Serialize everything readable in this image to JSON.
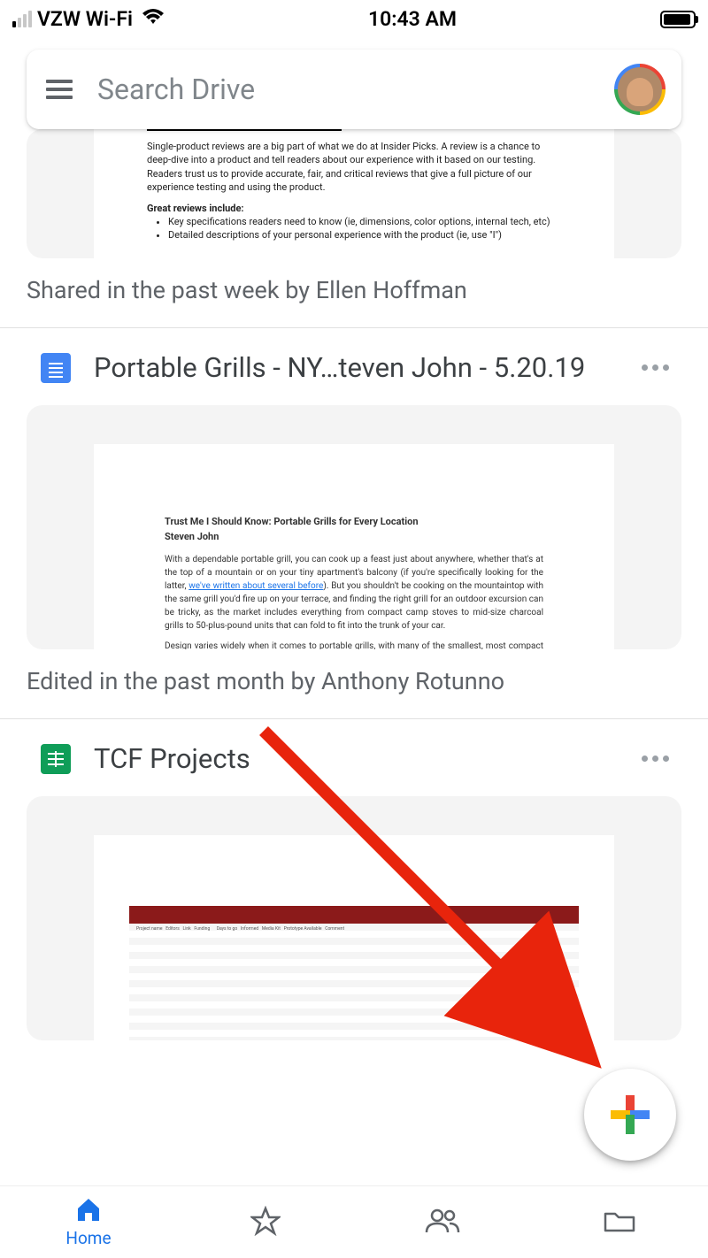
{
  "status": {
    "carrier": "VZW Wi-Fi",
    "time": "10:43 AM"
  },
  "search": {
    "placeholder": "Search Drive"
  },
  "doc1": {
    "preview": {
      "p1": "Single-product reviews are a big part of what we do at Insider Picks. A review is a chance to deep-dive into a product and tell readers about our experience with it based on our testing. Readers trust us to provide accurate, fair, and critical reviews that give a full picture of our experience testing and using the product.",
      "p2": "Great reviews include:",
      "b1": "Key specifications readers need to know (ie, dimensions, color options, internal tech, etc)",
      "b2": "Detailed descriptions of your personal experience with the product (ie, use \"I\")"
    },
    "meta": "Shared in the past week by Ellen Hoffman"
  },
  "doc2": {
    "title": "Portable Grills - NY…teven John - 5.20.19",
    "preview": {
      "t1": "Trust Me I Should Know: Portable Grills for Every Location",
      "t2": "Steven John",
      "p1a": "With a dependable portable grill, you can cook up a feast just about anywhere, whether that's at the top of a mountain or on your tiny apartment's balcony (if you're specifically looking for the latter, ",
      "link": "we've written about several before",
      "p1b": "). But you shouldn't be cooking on the mountaintop with the same grill you'd fire up on your terrace, and finding the right grill for an outdoor excursion can be tricky, as the market includes everything from compact camp stoves to mid-size charcoal grills to 50-plus-pound units that can fold to fit into the trunk of your car.",
      "p2": "Design varies widely when it comes to portable grills, with many of the smallest, most compact units offering a fine burner or two, but no actual grilling surface. Larger ones can have grates to"
    },
    "meta": "Edited in the past month by Anthony Rotunno"
  },
  "doc3": {
    "title": "TCF Projects"
  },
  "nav": {
    "home": "Home"
  },
  "colors": {
    "blue": "#4285f4",
    "red": "#ea4335",
    "yellow": "#fbbc04",
    "green": "#34a853"
  }
}
